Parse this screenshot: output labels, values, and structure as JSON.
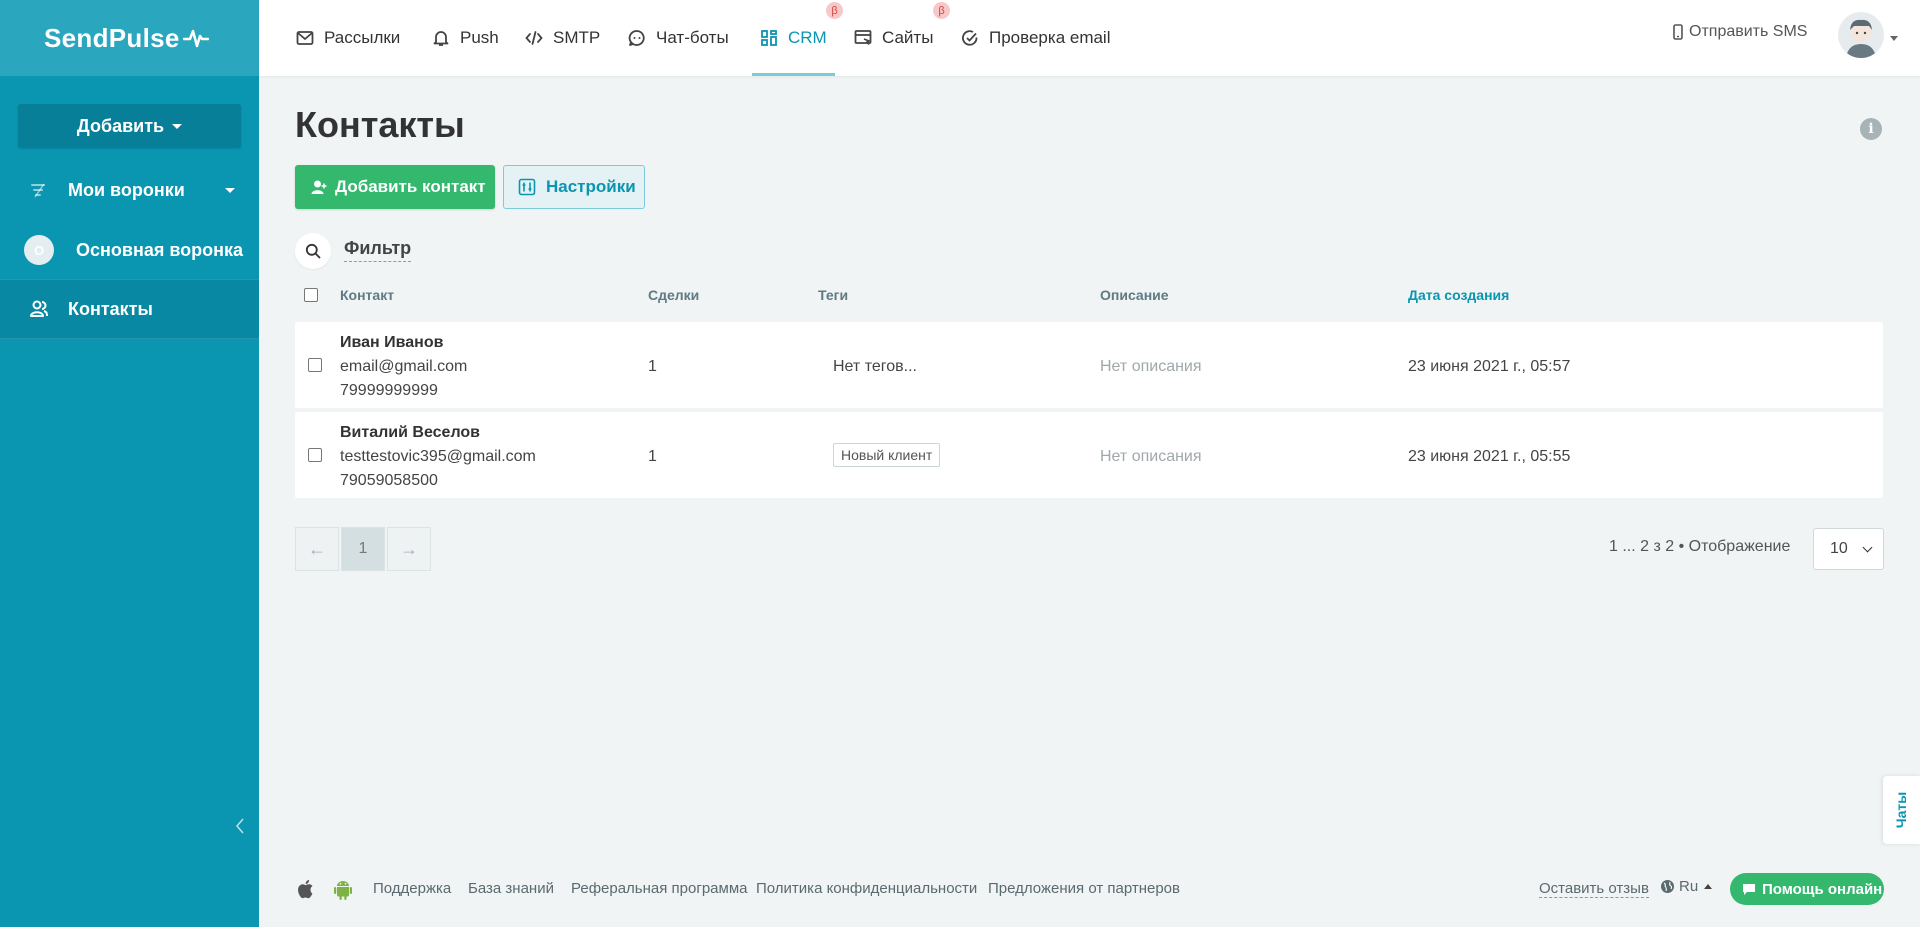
{
  "brand": {
    "logo_text": "SendPulse"
  },
  "sidebar": {
    "add_label": "Добавить",
    "items": [
      {
        "label": "Мои воронки"
      },
      {
        "label": "Основная воронка",
        "badge": "О"
      },
      {
        "label": "Контакты"
      }
    ]
  },
  "topnav": {
    "items": [
      {
        "label": "Рассылки",
        "icon": "mail-icon"
      },
      {
        "label": "Push",
        "icon": "bell-icon"
      },
      {
        "label": "SMTP",
        "icon": "code-icon"
      },
      {
        "label": "Чат-боты",
        "icon": "chat-bot-icon"
      },
      {
        "label": "CRM",
        "icon": "crm-icon",
        "beta": "β",
        "active": true
      },
      {
        "label": "Сайты",
        "icon": "website-icon",
        "beta": "β"
      },
      {
        "label": "Проверка email",
        "icon": "check-circle-icon"
      }
    ],
    "sms_label": "Отправить SMS"
  },
  "page": {
    "title": "Контакты",
    "add_contact_label": "Добавить контакт",
    "settings_label": "Настройки",
    "filter_label": "Фильтр"
  },
  "table": {
    "headers": [
      "Контакт",
      "Сделки",
      "Теги",
      "Описание",
      "Дата создания"
    ],
    "rows": [
      {
        "name": "Иван Иванов",
        "email": "email@gmail.com",
        "phone": "79999999999",
        "deals": "1",
        "tags": "Нет тегов...",
        "description": "Нет описания",
        "date": "23 июня 2021 г., 05:57"
      },
      {
        "name": "Виталий Веселов",
        "email": "testtestovic395@gmail.com",
        "phone": "79059058500",
        "deals": "1",
        "tag": "Новый клиент",
        "description": "Нет описания",
        "date": "23 июня 2021 г., 05:55"
      }
    ]
  },
  "pagination": {
    "prev": "←",
    "current": "1",
    "next": "→",
    "info": "1 ... 2 з 2  •  Отображение",
    "per_page": "10"
  },
  "footer": {
    "links": [
      "Поддержка",
      "База знаний",
      "Реферальная программа",
      "Политика конфиденциальности",
      "Предложения от партнеров"
    ],
    "feedback": "Оставить отзыв",
    "lang": "Ru",
    "help_label": "Помощь онлайн",
    "chats_label": "Чаты"
  },
  "colors": {
    "sidebar": "#0a95b1",
    "accent": "#0a95b1",
    "success": "#33b86e",
    "beta_badge": "#f8c8c8"
  }
}
